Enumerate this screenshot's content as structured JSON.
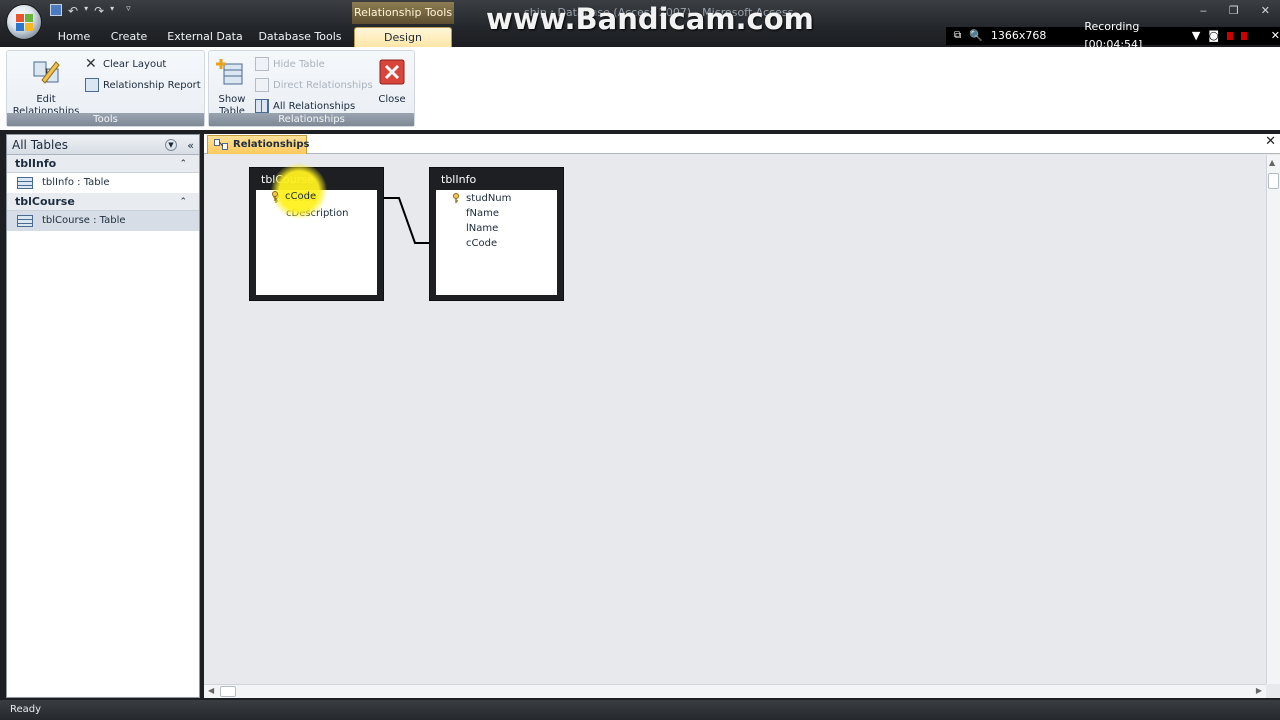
{
  "title_bar": {
    "context_tools_label": "Relationship Tools",
    "window_title": "ship : Database (Access 2007) - Microsoft Access",
    "watermark": "www.Bandicam.com"
  },
  "ribbon_tabs": [
    "Home",
    "Create",
    "External Data",
    "Database Tools",
    "Design"
  ],
  "recorder": {
    "resolution": "1366x768",
    "status": "Recording [00:04:54]"
  },
  "ribbon": {
    "tools_group": {
      "label": "Tools",
      "edit_relationships": "Edit Relationships",
      "clear_layout": "Clear Layout",
      "relationship_report": "Relationship Report"
    },
    "relationships_group": {
      "label": "Relationships",
      "show_table": "Show Table",
      "hide_table": "Hide Table",
      "direct_relationships": "Direct Relationships",
      "all_relationships": "All Relationships",
      "close": "Close"
    }
  },
  "nav_pane": {
    "header": "All Tables",
    "groups": [
      {
        "name": "tblInfo",
        "item": "tblInfo : Table"
      },
      {
        "name": "tblCourse",
        "item": "tblCourse : Table"
      }
    ]
  },
  "document": {
    "tab_label": "Relationships",
    "tables": [
      {
        "name": "tblCourse",
        "fields": [
          "cCode",
          "cDescription"
        ],
        "primary_key": "cCode"
      },
      {
        "name": "tblInfo",
        "fields": [
          "studNum",
          "fName",
          "lName",
          "cCode"
        ],
        "primary_key": "studNum"
      }
    ]
  },
  "status_bar": {
    "text": "Ready"
  },
  "colors": {
    "design_tab": "#ffe6a6",
    "relationships_tab": "#ffc95c",
    "highlight": "#fff01e",
    "canvas": "#e7e9ec"
  }
}
